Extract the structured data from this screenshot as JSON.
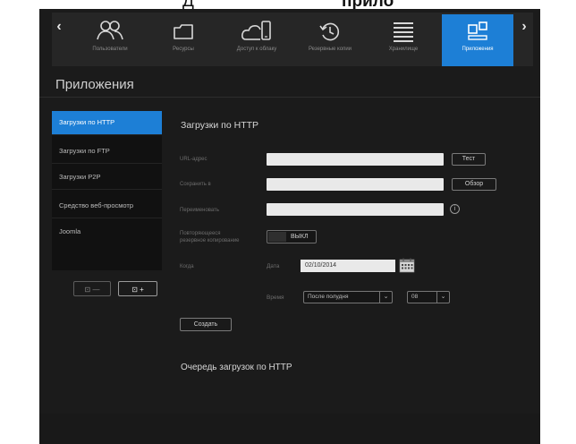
{
  "top_fragment": {
    "left": "Д",
    "right": "прило"
  },
  "nav": {
    "prev_arrow": "‹",
    "next_arrow": "›",
    "items": [
      {
        "label": "Пользователи",
        "icon": "users-icon"
      },
      {
        "label": "Ресурсы",
        "icon": "folder-icon"
      },
      {
        "label": "Доступ к облаку",
        "icon": "cloud-device-icon"
      },
      {
        "label": "Резервные копии",
        "icon": "history-icon"
      },
      {
        "label": "Хранилище",
        "icon": "storage-lines-icon"
      },
      {
        "label": "Приложения",
        "icon": "apps-icon",
        "active": true
      }
    ]
  },
  "page_title": "Приложения",
  "sidebar": {
    "items": [
      {
        "label": "Загрузки по HTTP",
        "active": true
      },
      {
        "label": "Загрузки по FTP"
      },
      {
        "label": "Загрузки P2P"
      },
      {
        "label": "Средство веб-просмотр"
      },
      {
        "label": "Joomla"
      }
    ],
    "remove_button": "⊡ —",
    "add_button": "⊡ +"
  },
  "form": {
    "title": "Загрузки по HTTP",
    "url_label": "URL-адрес",
    "url_value": "",
    "test_button": "Тест",
    "save_to_label": "Сохранить в",
    "save_to_value": "",
    "browse_button": "Обзор",
    "rename_label": "Переименовать",
    "rename_value": "",
    "info_icon": "i",
    "repeat_label_1": "Повторяющееся",
    "repeat_label_2": "резервное копирование",
    "repeat_toggle": "ВЫКЛ",
    "when_label": "Когда",
    "date_label": "Дата",
    "date_value": "02/10/2014",
    "time_label": "Время",
    "period_value": "После полудня",
    "hour_value": "08",
    "create_button": "Создать"
  },
  "queue_title": "Очередь загрузок по HTTP",
  "colors": {
    "accent": "#1d7fd6",
    "background": "#1b1b1b"
  }
}
